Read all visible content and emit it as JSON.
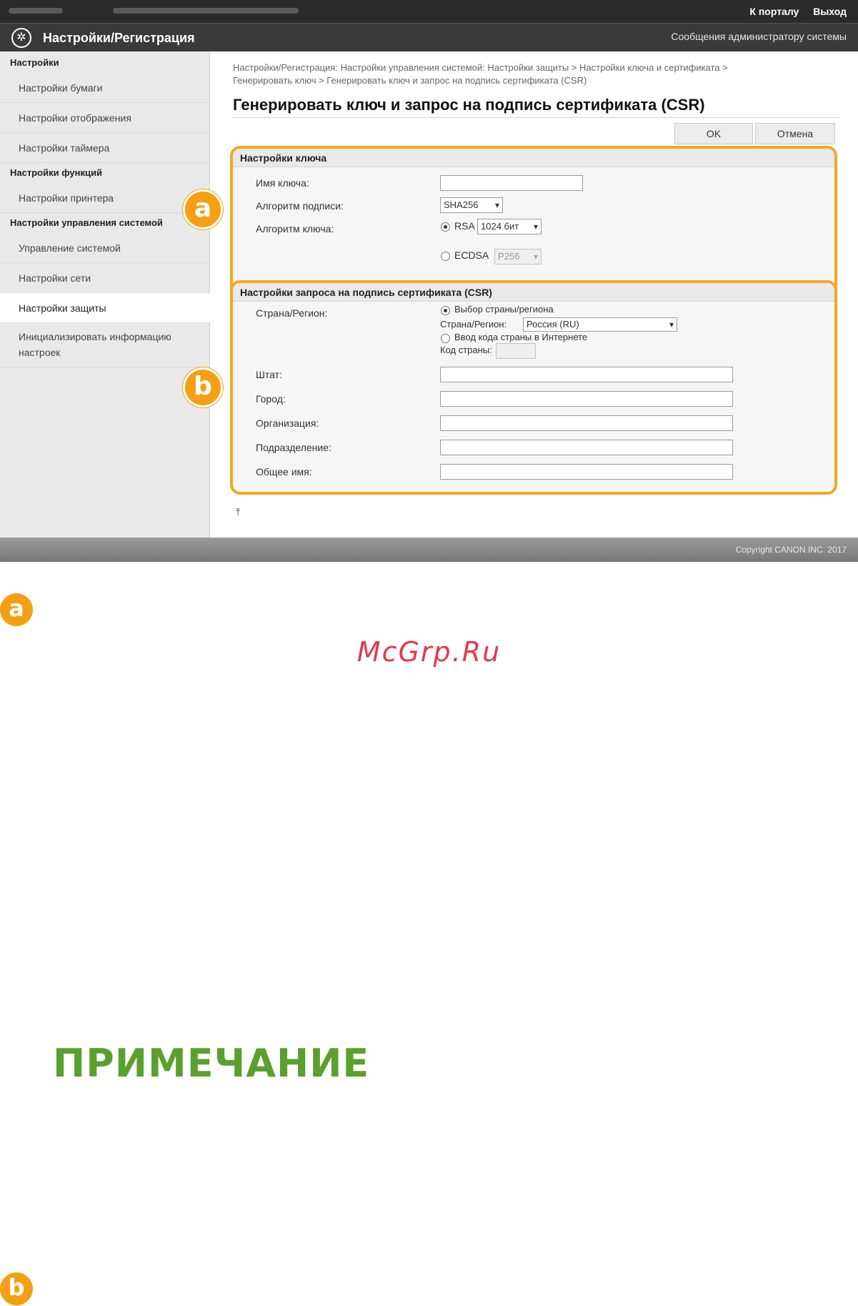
{
  "topbar": {
    "portal_link": "К порталу",
    "logout_link": "Выход"
  },
  "header": {
    "app_title": "Настройки/Регистрация",
    "admin_message": "Сообщения администратору системы",
    "logo_icon": "settings-gear-icon"
  },
  "sidebar": {
    "section_settings": "Настройки",
    "paper_settings": "Настройки бумаги",
    "display_settings": "Настройки отображения",
    "timer_settings": "Настройки таймера",
    "section_function": "Настройки функций",
    "printer_settings": "Настройки принтера",
    "section_system": "Настройки управления системой",
    "system_management": "Управление системой",
    "network_settings": "Настройки сети",
    "security_settings": "Настройки защиты",
    "init_info_line1": "Инициализировать информацию",
    "init_info_line2": "настроек"
  },
  "main": {
    "breadcrumb_line1": "Настройки/Регистрация: Настройки управления системой: Настройки защиты > Настройки ключа и сертификата >",
    "breadcrumb_line2": "Генерировать ключ > Генерировать ключ и запрос на подпись сертификата (CSR)",
    "title": "Генерировать ключ и запрос на подпись сертификата (CSR)",
    "ok_label": "OK",
    "cancel_label": "Отмена"
  },
  "key_panel": {
    "header": "Настройки ключа",
    "key_name_label": "Имя ключа:",
    "key_name_value": "",
    "sig_algo_label": "Алгоритм подписи:",
    "sig_algo_value": "SHA256",
    "key_algo_label": "Алгоритм ключа:",
    "rsa_label": "RSA",
    "rsa_value": "1024 бит",
    "ecdsa_label": "ECDSA",
    "ecdsa_value": "P256",
    "badge": "a"
  },
  "csr_panel": {
    "header": "Настройки запроса на подпись сертификата (CSR)",
    "country_label": "Страна/Регион:",
    "choose_country": "Выбор страны/региона",
    "country_select_label": "Страна/Регион:",
    "country_select_value": "Россия (RU)",
    "enter_code": "Ввод кода страны в Интернете",
    "country_code_label": "Код страны:",
    "state_label": "Штат:",
    "city_label": "Город:",
    "org_label": "Организация:",
    "dept_label": "Подразделение:",
    "cn_label": "Общее имя:",
    "badge": "b"
  },
  "footer": {
    "copyright": "Copyright CANON INC. 2017"
  },
  "doc": {
    "badge_a": "a",
    "watermark": "McGrp.Ru",
    "note_title": "ПРИМЕЧАНИЕ",
    "badge_b": "b"
  },
  "colors": {
    "accent_orange": "#f5a012",
    "note_green": "#5aa02c",
    "watermark_red": "#e23a4a"
  }
}
